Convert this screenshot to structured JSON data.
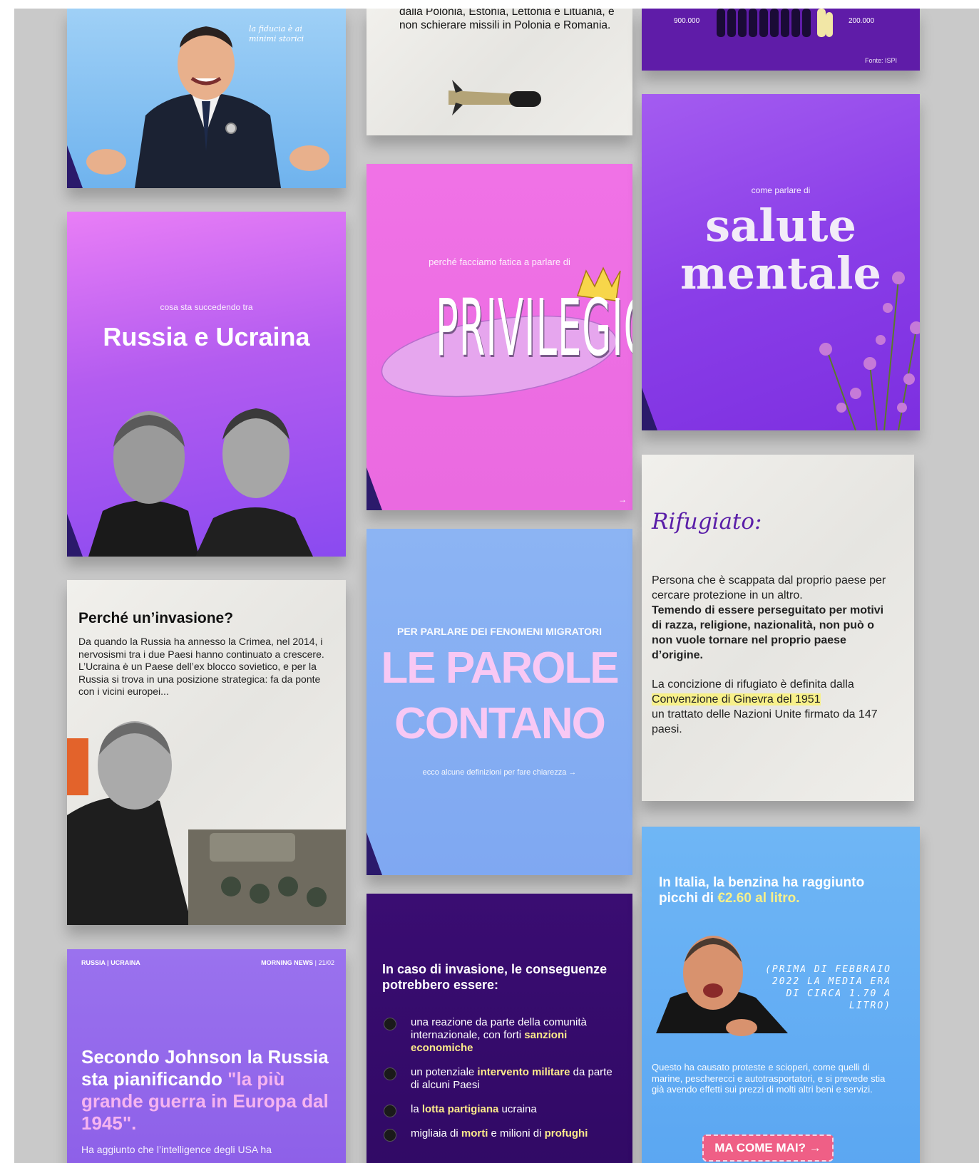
{
  "cards": {
    "berlusconi": {
      "handwriting": "la fiducia è ai minimi storici"
    },
    "missili": {
      "text": "dalla Polonia, Estonia, Lettonia e Lituania, e non schierare missili in Polonia e Romania."
    },
    "isp": {
      "left_value": "900.000",
      "right_value": "200.000",
      "source": "Fonte: ISPI"
    },
    "russia_ucraina": {
      "kicker": "cosa sta succedendo tra",
      "title": "Russia e Ucraina"
    },
    "privilegio": {
      "kicker": "perché facciamo fatica a parlare di",
      "title": "PRIVILEGIO"
    },
    "salute": {
      "kicker": "come parlare di",
      "title_line1": "salute",
      "title_line2": "mentale"
    },
    "invasione": {
      "title": "Perché un’invasione?",
      "body": "Da quando la Russia ha annesso la Crimea, nel 2014, i nervosismi tra i due Paesi hanno continuato a crescere. L’Ucraina è un Paese dell’ex blocco sovietico, e per la Russia si trova in una posizione strategica: fa da ponte con i vicini europei..."
    },
    "parole": {
      "kicker": "PER PARLARE DEI FENOMENI MIGRATORI",
      "title_line1": "LE PAROLE",
      "title_line2": "CONTANO",
      "footer": "ecco alcune definizioni per fare chiarezza →"
    },
    "rifugiato": {
      "title": "Rifugiato:",
      "p1_plain": "Persona che è scappata dal proprio paese per cercare protezione in un altro.",
      "p1_bold": "Temendo di essere perseguitato per motivi di razza, religione, nazionalità, non può o non vuole tornare nel proprio paese d’origine.",
      "p2_plain": "La concizione di rifugiato è definita dalla",
      "p2_highlight": "Convenzione di Ginevra del 1951",
      "p2_rest": "un trattato delle Nazioni Unite firmato da 147 paesi."
    },
    "johnson": {
      "tag_left": "RUSSIA | UCRAINA",
      "tag_right": "MORNING NEWS",
      "tag_date": "21/02",
      "title_plain": "Secondo Johnson la Russia sta pianificando",
      "title_quote": "\"la più grande guerra in Europa dal 1945\".",
      "body": "Ha aggiunto che l’intelligence degli USA ha"
    },
    "conseguenze": {
      "title": "In caso di invasione, le conseguenze potrebbero essere:",
      "items": [
        {
          "pre": "una reazione da parte della comunità internazionale, con forti ",
          "bold": "sanzioni economiche",
          "post": ""
        },
        {
          "pre": "un potenziale ",
          "bold": "intervento militare",
          "post": " da parte di alcuni Paesi"
        },
        {
          "pre": "la ",
          "bold": "lotta partigiana",
          "post": " ucraina"
        },
        {
          "pre": "migliaia di ",
          "bold": "morti",
          "post": " e milioni di ",
          "bold2": "profughi"
        }
      ]
    },
    "benzina": {
      "title_plain": "In Italia, la benzina ha raggiunto picchi di ",
      "title_hl": "€2.60 al litro.",
      "handwriting": "(PRIMA DI FEBBRAIO 2022 LA MEDIA ERA DI CIRCA 1.70 A LITRO)",
      "body": "Questo ha causato proteste e scioperi, come quelli di marine, pescherecci e autotrasportatori, e si prevede stia già avendo effetti sui prezzi di molti altri beni e servizi.",
      "button": "MA COME MAI? →"
    }
  },
  "colors": {
    "brand_purple": "#5f1ca8",
    "highlight_yellow": "#f7f08a",
    "pink_quote": "#f6b4f0",
    "button_pink": "#ef5f86"
  }
}
